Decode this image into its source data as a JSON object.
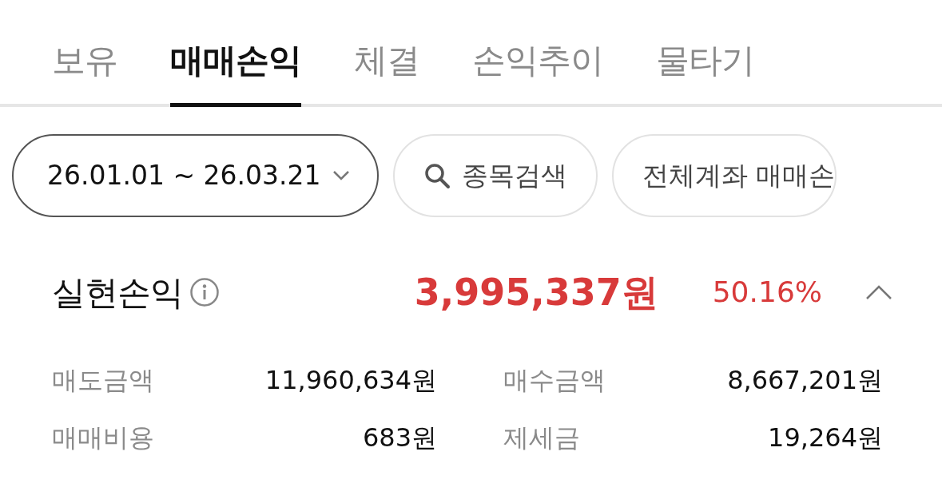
{
  "tabs": [
    {
      "label": "보유",
      "selected": false
    },
    {
      "label": "매매손익",
      "selected": true
    },
    {
      "label": "체결",
      "selected": false
    },
    {
      "label": "손익추이",
      "selected": false
    },
    {
      "label": "물타기",
      "selected": false
    }
  ],
  "filters": [
    {
      "kind": "date",
      "label": "26.01.01 ~ 26.03.21"
    },
    {
      "kind": "search",
      "label": "종목검색"
    },
    {
      "kind": "select",
      "label": "전체계좌 매매손"
    }
  ],
  "summary": {
    "title": "실현손익",
    "amount": "3,995,337원",
    "rate": "50.16%",
    "expanded": true
  },
  "details": [
    {
      "label": "매도금액",
      "value": "11,960,634원"
    },
    {
      "label": "매수금액",
      "value": "8,667,201원"
    },
    {
      "label": "매매비용",
      "value": "683원"
    },
    {
      "label": "제세금",
      "value": "19,264원"
    }
  ]
}
